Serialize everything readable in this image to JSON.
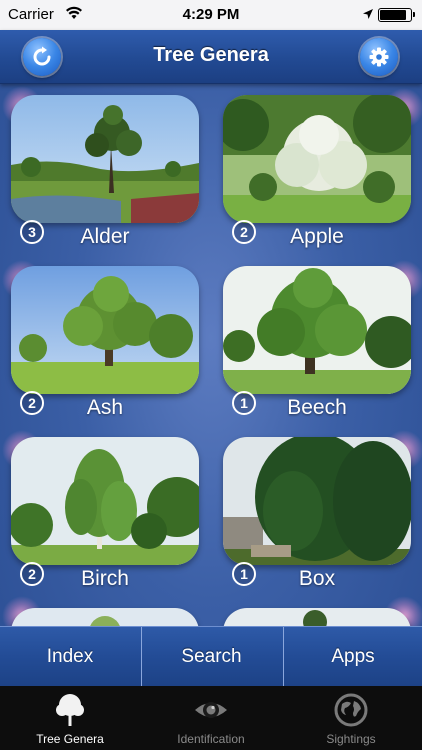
{
  "status_bar": {
    "carrier": "Carrier",
    "time": "4:29 PM"
  },
  "nav": {
    "title": "Tree Genera"
  },
  "genera": [
    {
      "name": "Alder",
      "count": "3"
    },
    {
      "name": "Apple",
      "count": "2"
    },
    {
      "name": "Ash",
      "count": "2"
    },
    {
      "name": "Beech",
      "count": "1"
    },
    {
      "name": "Birch",
      "count": "2"
    },
    {
      "name": "Box",
      "count": "1"
    }
  ],
  "toolbar": {
    "index": "Index",
    "search": "Search",
    "apps": "Apps"
  },
  "tabs": [
    {
      "label": "Tree Genera",
      "icon": "tree-icon",
      "active": true
    },
    {
      "label": "Identification",
      "icon": "eye-icon",
      "active": false
    },
    {
      "label": "Sightings",
      "icon": "globe-icon",
      "active": false
    }
  ],
  "colors": {
    "nav_bar": "#224a93",
    "background": "#3b5fa6",
    "tab_bar": "#0d0d0d",
    "accent_button": "#3a86e6"
  }
}
